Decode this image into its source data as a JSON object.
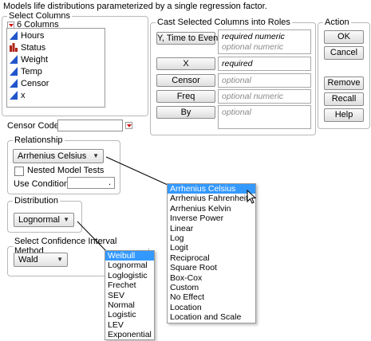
{
  "description": "Models life distributions parameterized by a single regression factor.",
  "select_columns": {
    "legend": "Select Columns",
    "count_label": "6 Columns",
    "items": [
      {
        "label": "Hours",
        "icon": "continuous-icon"
      },
      {
        "label": "Status",
        "icon": "nominal-icon"
      },
      {
        "label": "Weight",
        "icon": "continuous-icon"
      },
      {
        "label": "Temp",
        "icon": "continuous-icon"
      },
      {
        "label": "Censor",
        "icon": "continuous-icon"
      },
      {
        "label": "x",
        "icon": "continuous-icon"
      }
    ]
  },
  "roles": {
    "legend": "Cast Selected Columns into Roles",
    "items": [
      {
        "button": "Y, Time to Event",
        "lines": [
          {
            "text": "required numeric",
            "kind": "required"
          },
          {
            "text": "optional numeric",
            "kind": "optional"
          }
        ]
      },
      {
        "button": "X",
        "lines": [
          {
            "text": "required",
            "kind": "required"
          }
        ]
      },
      {
        "button": "Censor",
        "lines": [
          {
            "text": "optional",
            "kind": "optional"
          }
        ]
      },
      {
        "button": "Freq",
        "lines": [
          {
            "text": "optional numeric",
            "kind": "optional"
          }
        ]
      },
      {
        "button": "By",
        "lines": [
          {
            "text": "optional",
            "kind": "optional"
          }
        ]
      }
    ]
  },
  "action": {
    "legend": "Action",
    "ok": "OK",
    "cancel": "Cancel",
    "remove": "Remove",
    "recall": "Recall",
    "help": "Help"
  },
  "censor_code": {
    "label": "Censor Code:",
    "value": ""
  },
  "relationship": {
    "legend": "Relationship",
    "selected": "Arrhenius Celsius",
    "nested_label": "Nested Model Tests",
    "nested_checked": false,
    "use_condition_label": "Use Condition",
    "use_condition_value": "."
  },
  "distribution": {
    "legend": "Distribution",
    "selected": "Lognormal"
  },
  "confidence": {
    "legend": "Select Confidence Interval Method",
    "selected": "Wald"
  },
  "relationship_options": [
    "Arrhenius Celsius",
    "Arrhenius Fahrenheit",
    "Arrhenius Kelvin",
    "Inverse Power",
    "Linear",
    "Log",
    "Logit",
    "Reciprocal",
    "Square Root",
    "Box-Cox",
    "Custom",
    "No Effect",
    "Location",
    "Location and Scale"
  ],
  "distribution_options": [
    "Weibull",
    "Lognormal",
    "Loglogistic",
    "Frechet",
    "SEV",
    "Normal",
    "Logistic",
    "LEV",
    "Exponential"
  ],
  "highlighted": {
    "relationship": "Arrhenius Celsius",
    "distribution": "Weibull"
  },
  "colors": {
    "selection": "#3399ff",
    "column_icon": "#2255cc",
    "nominal_icon": "#b0261b",
    "menu_arrow": "#d01818"
  }
}
